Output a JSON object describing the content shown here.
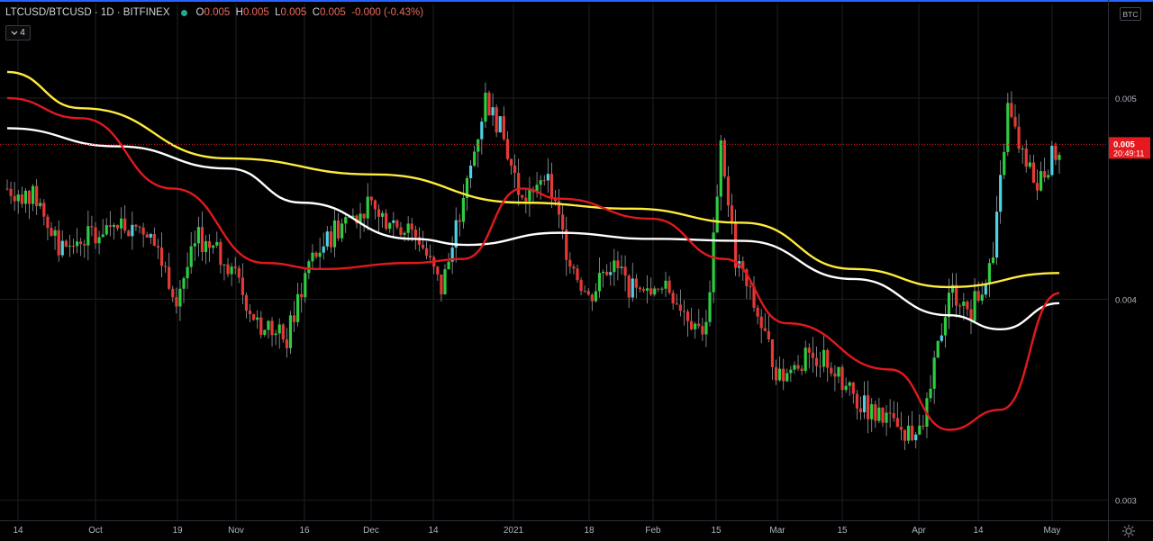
{
  "legend": {
    "symbol": "LTCUSD/BTCUSD · 1D · BITFINEX",
    "open_label": "O",
    "open": "0.005",
    "high_label": "H",
    "high": "0.005",
    "low_label": "L",
    "low": "0.005",
    "close_label": "C",
    "close": "0.005",
    "change": "-0.000 (-0.43%)"
  },
  "indicator_toggle": {
    "icon": "chevron-down-icon",
    "count": "4"
  },
  "currency_badge": "BTC",
  "price_label": {
    "price": "0.005",
    "countdown": "20:49:11"
  },
  "settings_icon": "gear-icon",
  "colors": {
    "background": "#000000",
    "up_candle": "#2ecc40",
    "up_candle_alt": "#4dd0e1",
    "down_candle": "#e53935",
    "ma_white": "#ffffff",
    "ma_yellow": "#ffeb3b",
    "ma_red": "#e0191e",
    "price_label_bg": "#e5191e",
    "grid": "#1c1f26"
  },
  "chart_data": {
    "type": "candlestick",
    "ylim": [
      0.0029,
      0.00547
    ],
    "y_ticks": [
      0.003,
      0.004,
      0.005
    ],
    "y_tick_labels": [
      "0.003",
      "0.004",
      "0.005"
    ],
    "x_ticks": [
      "14",
      "Oct",
      "19",
      "Nov",
      "16",
      "Dec",
      "14",
      "2021",
      "18",
      "Feb",
      "15",
      "Mar",
      "15",
      "Apr",
      "14",
      "May"
    ],
    "current_price": 0.00477,
    "bars": 286
  }
}
